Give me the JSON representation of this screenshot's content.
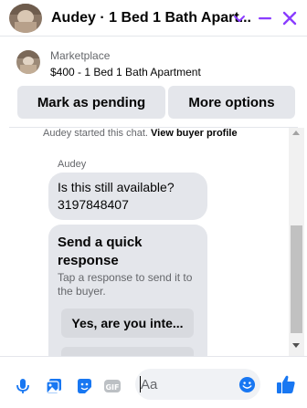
{
  "header": {
    "title": "Audey · 1 Bed 1 Bath Apart...",
    "accent": "#8a3cff"
  },
  "listing": {
    "source": "Marketplace",
    "summary": "$400 - 1 Bed 1 Bath Apartment"
  },
  "actions": {
    "mark_pending": "Mark as pending",
    "more_options": "More options"
  },
  "chat": {
    "started_text": "Audey started this chat.",
    "view_profile": "View buyer profile",
    "sender": "Audey",
    "message_line1": "Is this still available?",
    "message_line2": "3197848407",
    "quick_title": "Send a quick response",
    "quick_subtitle": "Tap a response to send it to the buyer.",
    "quick_option_1": "Yes, are you inte..."
  },
  "composer": {
    "placeholder": "Aa",
    "icons": [
      "microphone-icon",
      "photo-icon",
      "sticker-icon",
      "gif-icon",
      "emoji-icon",
      "like-icon"
    ],
    "brand_color": "#1877f2"
  }
}
